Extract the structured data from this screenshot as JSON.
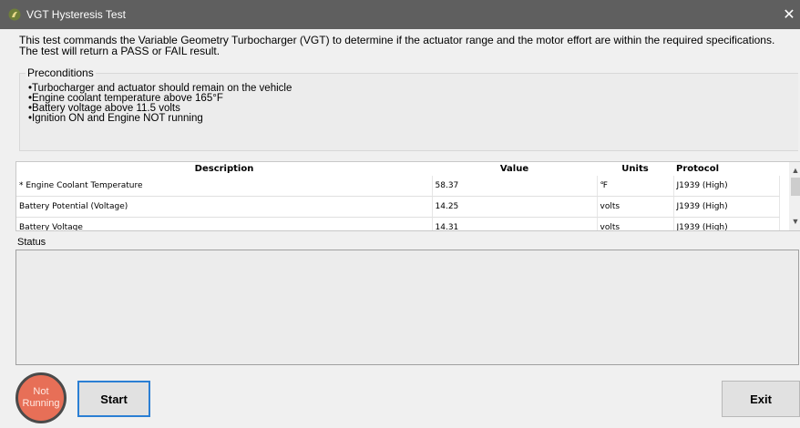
{
  "window": {
    "title": "VGT Hysteresis Test",
    "close_icon": "close-icon",
    "app_icon": "app-logo-icon"
  },
  "description": {
    "line1": "This test commands the Variable Geometry Turbocharger (VGT) to determine if the actuator range and the motor effort are within the required specifications.",
    "line2": "The test will return a PASS or FAIL result."
  },
  "preconditions": {
    "title": "Preconditions",
    "items": [
      "Turbocharger and actuator should remain on the vehicle",
      "Engine coolant temperature above 165°F",
      "Battery voltage above 11.5 volts",
      "Ignition ON and Engine NOT running"
    ]
  },
  "table": {
    "headers": {
      "description": "Description",
      "value": "Value",
      "units": "Units",
      "protocol": "Protocol"
    },
    "rows": [
      {
        "description": "* Engine Coolant Temperature",
        "value": "58.37",
        "units": "℉",
        "protocol": "J1939 (High)"
      },
      {
        "description": "Battery Potential (Voltage)",
        "value": "14.25",
        "units": "volts",
        "protocol": "J1939 (High)"
      },
      {
        "description": "Battery Voltage",
        "value": "14.31",
        "units": "volts",
        "protocol": "J1939 (High)"
      }
    ]
  },
  "status": {
    "label": "Status",
    "text": ""
  },
  "indicator": {
    "line1": "Not",
    "line2": "Running",
    "color": "#e76f57"
  },
  "buttons": {
    "start": "Start",
    "exit": "Exit"
  },
  "colors": {
    "titlebar": "#5f5f5f",
    "accent_border": "#2b7fd4"
  }
}
